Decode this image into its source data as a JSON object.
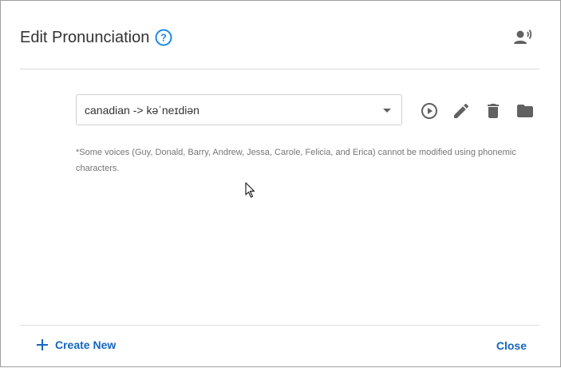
{
  "dialog": {
    "title": "Edit Pronunciation",
    "help_icon": "help-circle-icon",
    "header_icon": "speaker-voice-icon"
  },
  "entry": {
    "selected_value": "canadian -> kəˈneɪdiən",
    "actions": [
      "play-icon",
      "edit-icon",
      "delete-icon",
      "folder-icon"
    ]
  },
  "note": "*Some voices (Guy, Donald, Barry, Andrew, Jessa, Carole, Felicia, and Erica) cannot be modified using phonemic characters.",
  "footer": {
    "create_label": "Create New",
    "close_label": "Close"
  },
  "colors": {
    "accent": "#1565c0",
    "help_icon": "#1e88e5",
    "icon_gray": "#616161",
    "divider": "#dcdcdc"
  }
}
